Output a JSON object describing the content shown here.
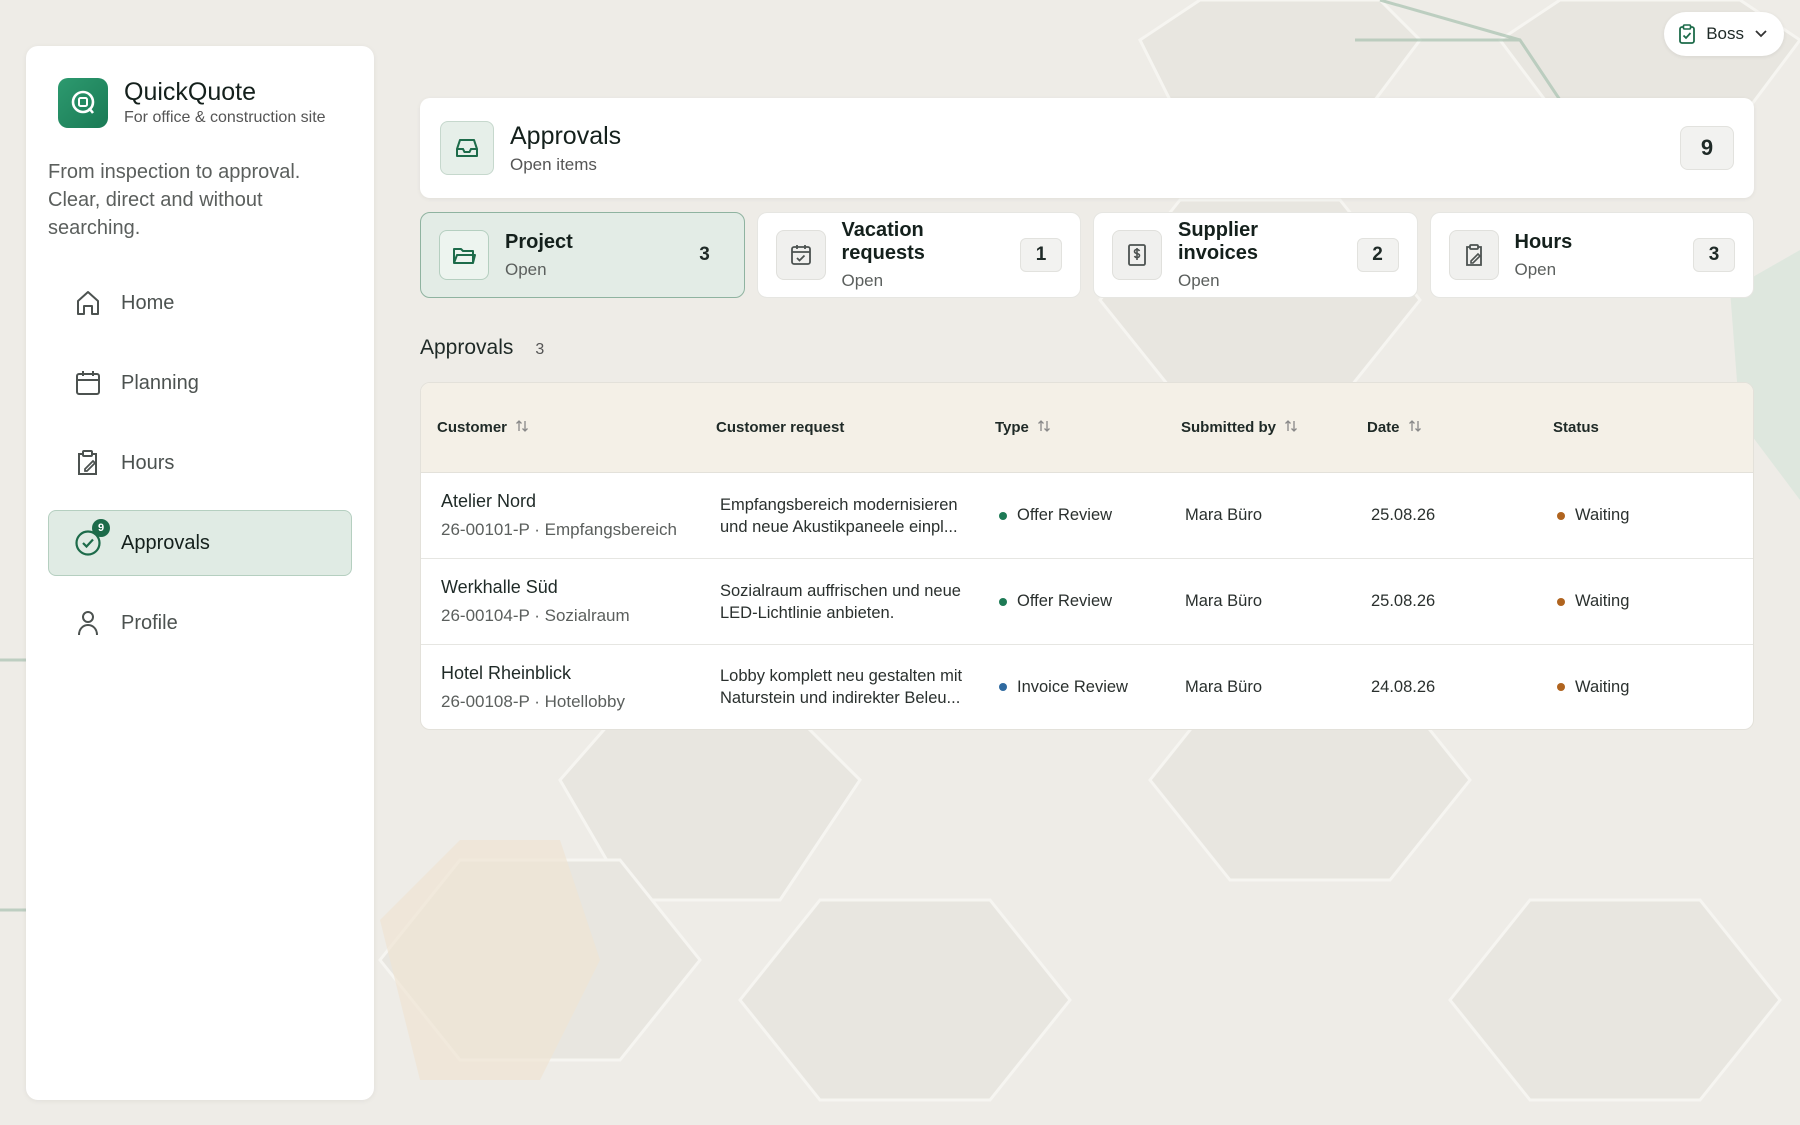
{
  "app": {
    "name": "QuickQuote",
    "subtitle": "For office & construction site",
    "tagline": "From inspection to approval. Clear, direct and without searching."
  },
  "user_menu": {
    "label": "Boss"
  },
  "nav": [
    {
      "label": "Home",
      "icon": "home-icon",
      "active": false
    },
    {
      "label": "Planning",
      "icon": "calendar-icon",
      "active": false
    },
    {
      "label": "Hours",
      "icon": "clipboard-edit-icon",
      "active": false
    },
    {
      "label": "Approvals",
      "icon": "check-circle-icon",
      "active": true,
      "badge": "9"
    },
    {
      "label": "Profile",
      "icon": "user-icon",
      "active": false
    }
  ],
  "header": {
    "title": "Approvals",
    "subtitle": "Open items",
    "count": "9",
    "icon": "inbox-icon"
  },
  "tabs": [
    {
      "title": "Project",
      "subtitle": "Open",
      "count": "3",
      "icon": "folder-icon",
      "active": true
    },
    {
      "title": "Vacation requests",
      "subtitle": "Open",
      "count": "1",
      "icon": "calendar-check-icon",
      "active": false
    },
    {
      "title": "Supplier invoices",
      "subtitle": "Open",
      "count": "2",
      "icon": "invoice-dollar-icon",
      "active": false
    },
    {
      "title": "Hours",
      "subtitle": "Open",
      "count": "3",
      "icon": "clipboard-edit-icon",
      "active": false
    }
  ],
  "section": {
    "title": "Approvals",
    "count": "3"
  },
  "table": {
    "columns": [
      "Customer",
      "Customer request",
      "Type",
      "Submitted by",
      "Date",
      "Status"
    ],
    "rows": [
      {
        "customer": "Atelier Nord",
        "ref": "26-00101-P · Empfangsbereich",
        "request_line1": "Empfangsbereich modernisieren",
        "request_line2": "und neue Akustikpaneele einpl...",
        "type": "Offer Review",
        "type_color": "#1d7a55",
        "submitted_by": "Mara Büro",
        "date": "25.08.26",
        "status": "Waiting",
        "status_color": "#b0641f"
      },
      {
        "customer": "Werkhalle Süd",
        "ref": "26-00104-P · Sozialraum",
        "request_line1": "Sozialraum auffrischen und neue",
        "request_line2": "LED-Lichtlinie anbieten.",
        "type": "Offer Review",
        "type_color": "#1d7a55",
        "submitted_by": "Mara Büro",
        "date": "25.08.26",
        "status": "Waiting",
        "status_color": "#b0641f"
      },
      {
        "customer": "Hotel Rheinblick",
        "ref": "26-00108-P · Hotellobby",
        "request_line1": "Lobby komplett neu gestalten mit",
        "request_line2": "Naturstein und indirekter Beleu...",
        "type": "Invoice Review",
        "type_color": "#2f6aa0",
        "submitted_by": "Mara Büro",
        "date": "24.08.26",
        "status": "Waiting",
        "status_color": "#b0641f"
      }
    ]
  },
  "colors": {
    "accent": "#1d6b4a",
    "active_bg": "#e0ebe4"
  }
}
